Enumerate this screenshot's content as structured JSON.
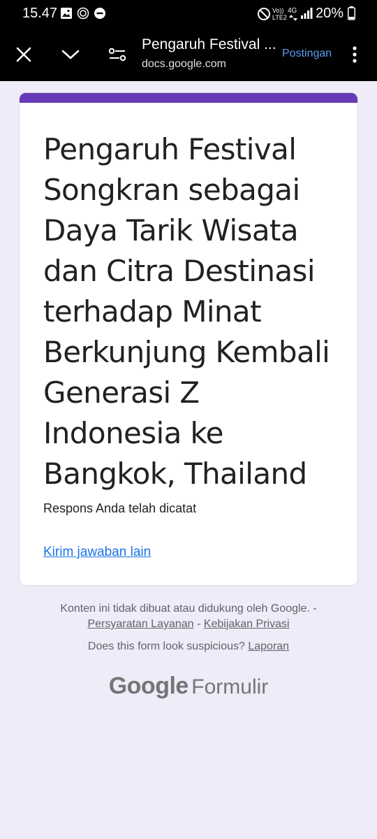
{
  "status_bar": {
    "time": "15.47",
    "network_label": "Vo)) LTE2",
    "network_type": "4G",
    "battery": "20%"
  },
  "app_bar": {
    "title": "Pengaruh Festival ...",
    "url": "docs.google.com",
    "post_label": "Postingan",
    "icons": [
      "close-icon",
      "chevron-down-icon",
      "tune-icon",
      "more-vert-icon"
    ]
  },
  "form": {
    "accent_color": "#673ab7",
    "title": "Pengaruh Festival Songkran sebagai Daya Tarik Wisata dan Citra Destinasi terhadap Minat Berkunjung Kembali Generasi Z Indonesia ke Bangkok, Thailand",
    "confirmation": "Respons Anda telah dicatat",
    "submit_another": "Kirim jawaban lain"
  },
  "footer": {
    "disclaimer": "Konten ini tidak dibuat atau didukung oleh Google. -",
    "terms": "Persyaratan Layanan",
    "separator": "-",
    "privacy": "Kebijakan Privasi",
    "suspicious": "Does this form look suspicious?",
    "report": "Laporan",
    "brand_google": "Google",
    "brand_product": "Formulir"
  }
}
